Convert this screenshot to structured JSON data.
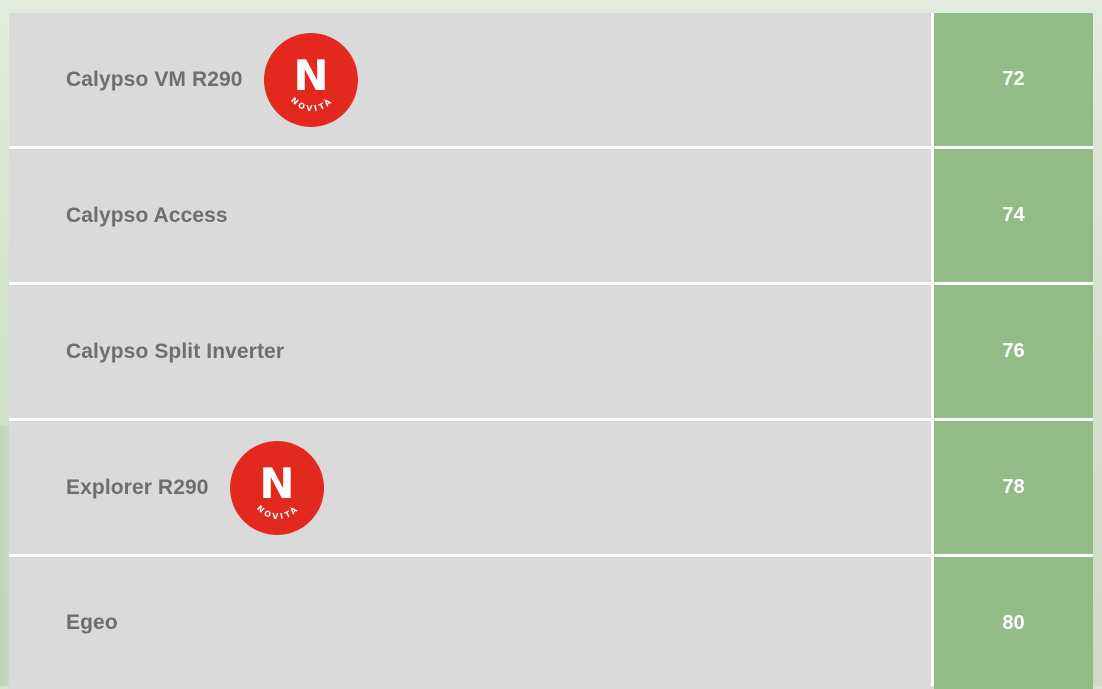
{
  "rows": [
    {
      "name": "Calypso VM R290",
      "page": "72",
      "badge": true
    },
    {
      "name": "Calypso Access",
      "page": "74",
      "badge": false
    },
    {
      "name": "Calypso Split Inverter",
      "page": "76",
      "badge": false
    },
    {
      "name": "Explorer R290",
      "page": "78",
      "badge": true
    },
    {
      "name": "Egeo",
      "page": "80",
      "badge": false
    }
  ],
  "badge": {
    "letter": "N",
    "word": "NOVITÀ",
    "icon": "novita-badge-icon",
    "color": "#e3281e"
  },
  "colors": {
    "name_cell": "#dadada",
    "page_cell": "#93bb88",
    "name_text": "#6e6e6e",
    "page_text": "#ffffff"
  }
}
